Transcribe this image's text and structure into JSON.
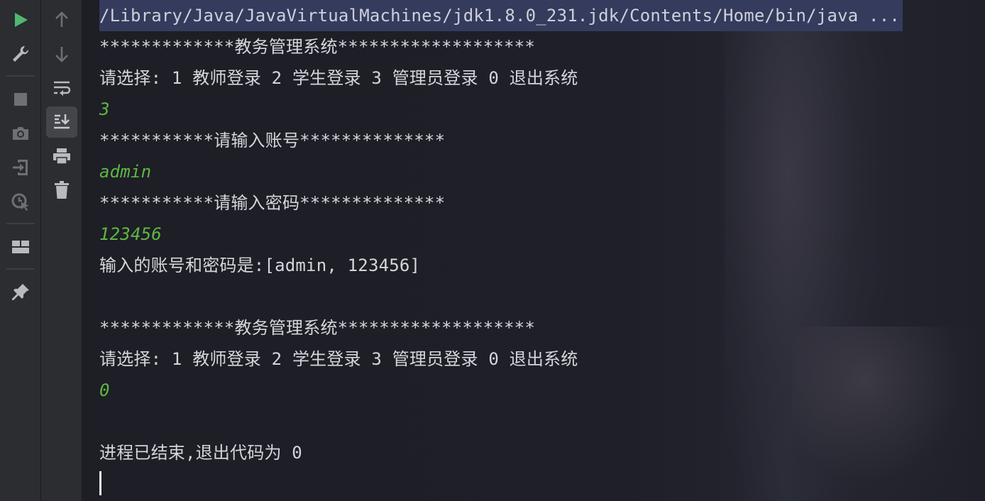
{
  "toolbar_left": {
    "items": [
      {
        "name": "run-icon",
        "color": "#4fb86f"
      },
      {
        "name": "build-wrench-icon"
      },
      {
        "name": "stop-icon"
      },
      {
        "name": "camera-icon"
      },
      {
        "name": "exit-login-icon"
      },
      {
        "name": "history-icon"
      },
      {
        "name": "layout-icon"
      },
      {
        "name": "pin-icon"
      }
    ]
  },
  "toolbar_right": {
    "items": [
      {
        "name": "up-arrow-icon"
      },
      {
        "name": "down-arrow-icon"
      },
      {
        "name": "soft-wrap-icon"
      },
      {
        "name": "scroll-to-end-icon",
        "active": true
      },
      {
        "name": "print-icon"
      },
      {
        "name": "trash-icon"
      }
    ]
  },
  "console": {
    "colors": {
      "input": "#5fb742",
      "text": "#d5d6da",
      "command_bg": "#353b5c"
    },
    "lines": [
      "/Library/Java/JavaVirtualMachines/jdk1.8.0_231.jdk/Contents/Home/bin/java ...",
      "*************教务管理系统*******************",
      "请选择: 1 教师登录 2 学生登录 3 管理员登录 0 退出系统",
      "3",
      "***********请输入账号**************",
      "admin",
      "***********请输入密码**************",
      "123456",
      "输入的账号和密码是:[admin, 123456]",
      "",
      "*************教务管理系统*******************",
      "请选择: 1 教师登录 2 学生登录 3 管理员登录 0 退出系统",
      "0",
      "",
      "进程已结束,退出代码为 0"
    ]
  }
}
